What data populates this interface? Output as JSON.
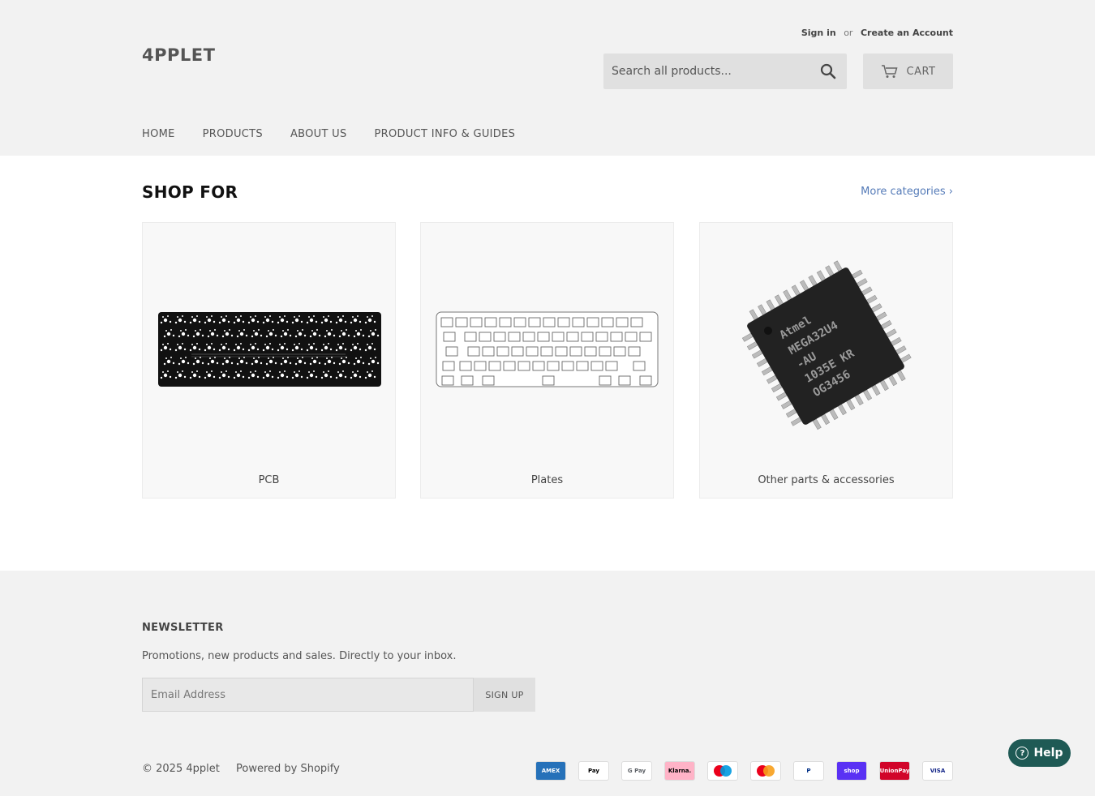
{
  "header": {
    "logo": "4PPLET",
    "sign_in": "Sign in",
    "or": "or",
    "create_account": "Create an Account",
    "search_placeholder": "Search all products...",
    "cart_label": "CART"
  },
  "nav": {
    "items": [
      {
        "label": "HOME"
      },
      {
        "label": "PRODUCTS"
      },
      {
        "label": "ABOUT US"
      },
      {
        "label": "PRODUCT INFO & GUIDES"
      }
    ]
  },
  "main": {
    "title": "SHOP FOR",
    "more_link": "More categories ›",
    "cards": [
      {
        "label": "PCB",
        "image": "keyboard-pcb"
      },
      {
        "label": "Plates",
        "image": "keyboard-plate"
      },
      {
        "label": "Other parts & accessories",
        "image": "microchip",
        "chip_text": [
          "Atmel",
          "MEGA32U4",
          "-AU",
          "1035E KR",
          "OG3456"
        ]
      }
    ]
  },
  "footer": {
    "newsletter_title": "NEWSLETTER",
    "newsletter_text": "Promotions, new products and sales. Directly to your inbox.",
    "email_placeholder": "Email Address",
    "signup_label": "SIGN UP",
    "copyright": "© 2025 4pplet",
    "powered_by": "Powered by Shopify",
    "payments": [
      {
        "name": "american-express",
        "text": "AMEX",
        "bg": "#2671b9",
        "fg": "#ffffff"
      },
      {
        "name": "apple-pay",
        "text": " Pay",
        "bg": "#ffffff",
        "fg": "#000000"
      },
      {
        "name": "google-pay",
        "text": "G Pay",
        "bg": "#ffffff",
        "fg": "#5f6368"
      },
      {
        "name": "klarna",
        "text": "Klarna.",
        "bg": "#ffb3c7",
        "fg": "#000000"
      },
      {
        "name": "maestro",
        "text": "",
        "bg": "#ffffff",
        "fg": "#000000"
      },
      {
        "name": "mastercard",
        "text": "",
        "bg": "#ffffff",
        "fg": "#000000"
      },
      {
        "name": "paypal",
        "text": "P",
        "bg": "#ffffff",
        "fg": "#003087"
      },
      {
        "name": "shop-pay",
        "text": "shop",
        "bg": "#5a31f4",
        "fg": "#ffffff"
      },
      {
        "name": "union-pay",
        "text": "UnionPay",
        "bg": "#d10429",
        "fg": "#ffffff"
      },
      {
        "name": "visa",
        "text": "VISA",
        "bg": "#ffffff",
        "fg": "#142688"
      }
    ]
  },
  "help": {
    "label": "Help",
    "icon_text": "?"
  }
}
